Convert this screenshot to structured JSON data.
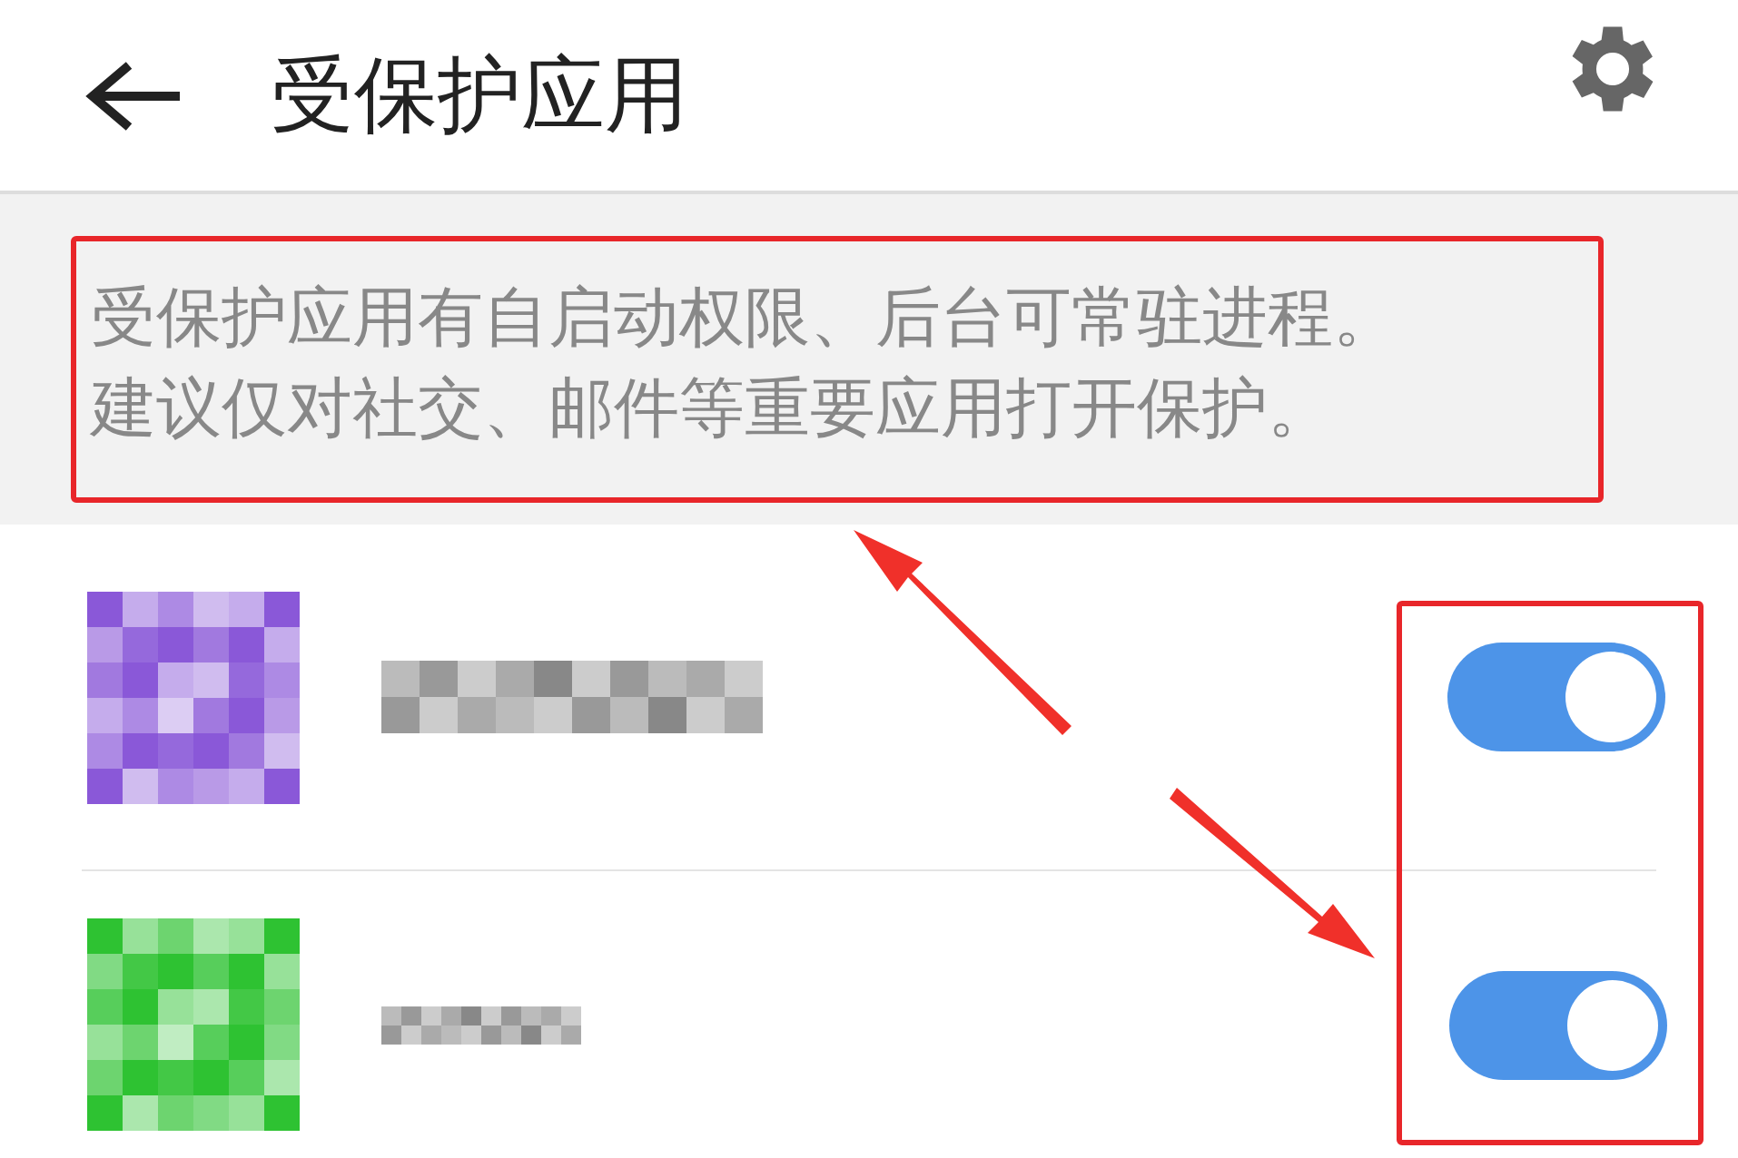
{
  "header": {
    "title": "受保护应用"
  },
  "notice": {
    "lines": [
      "受保护应用有自启动权限、后台可常驻进程。",
      "建议仅对社交、邮件等重要应用打开保护。"
    ]
  },
  "apps": [
    {
      "color": "#8a58d8",
      "on": true
    },
    {
      "color": "#2ec232",
      "on": true
    }
  ]
}
